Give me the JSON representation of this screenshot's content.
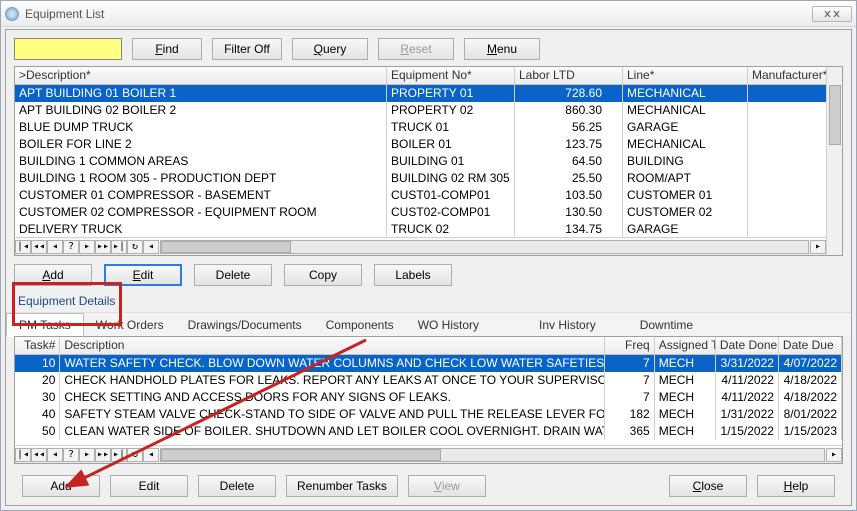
{
  "title": "Equipment List",
  "toolbar": {
    "find": "Find",
    "filter_off": "Filter Off",
    "query": "Query",
    "reset": "Reset",
    "menu": "Menu"
  },
  "columns": [
    ">Description*",
    "Equipment No*",
    "Labor LTD",
    "Line*",
    "Manufacturer*"
  ],
  "rows": [
    {
      "desc": "APT BUILDING 01 BOILER 1",
      "eq": "PROPERTY 01",
      "labor": "728.60",
      "line": "MECHANICAL",
      "mfr": ""
    },
    {
      "desc": "APT BUILDING 02 BOILER 2",
      "eq": "PROPERTY 02",
      "labor": "860.30",
      "line": "MECHANICAL",
      "mfr": ""
    },
    {
      "desc": "BLUE DUMP TRUCK",
      "eq": "TRUCK 01",
      "labor": "56.25",
      "line": "GARAGE",
      "mfr": ""
    },
    {
      "desc": "BOILER FOR LINE 2",
      "eq": "BOILER 01",
      "labor": "123.75",
      "line": "MECHANICAL",
      "mfr": ""
    },
    {
      "desc": "BUILDING 1 COMMON AREAS",
      "eq": "BUILDING 01",
      "labor": "64.50",
      "line": "BUILDING",
      "mfr": ""
    },
    {
      "desc": "BUILDING 1 ROOM 305 - PRODUCTION DEPT",
      "eq": "BUILDING 02 RM 305",
      "labor": "25.50",
      "line": "ROOM/APT",
      "mfr": ""
    },
    {
      "desc": "CUSTOMER 01 COMPRESSOR - BASEMENT",
      "eq": "CUST01-COMP01",
      "labor": "103.50",
      "line": "CUSTOMER 01",
      "mfr": ""
    },
    {
      "desc": "CUSTOMER 02 COMPRESSOR - EQUIPMENT ROOM",
      "eq": "CUST02-COMP01",
      "labor": "130.50",
      "line": "CUSTOMER 02",
      "mfr": ""
    },
    {
      "desc": "DELIVERY TRUCK",
      "eq": "TRUCK 02",
      "labor": "134.75",
      "line": "GARAGE",
      "mfr": ""
    }
  ],
  "crud": {
    "add": "Add",
    "edit": "Edit",
    "delete": "Delete",
    "copy": "Copy",
    "labels": "Labels"
  },
  "details_header": "Equipment Details",
  "tabs": [
    "PM Tasks",
    "Work Orders",
    "Drawings/Documents",
    "Components",
    "WO History",
    "Inv History",
    "Downtime"
  ],
  "columns2": [
    "Task#",
    "Description",
    "Freq",
    "Assigned T",
    "Date Done",
    "Date Due"
  ],
  "rows2": [
    {
      "t": "10",
      "d": "WATER SAFETY CHECK. BLOW DOWN WATER COLUMNS AND CHECK LOW WATER SAFETIES. IF THE",
      "f": "7",
      "a": "MECH",
      "done": "3/31/2022",
      "due": "4/07/2022"
    },
    {
      "t": "20",
      "d": "CHECK HANDHOLD PLATES FOR LEAKS. REPORT ANY LEAKS AT ONCE TO YOUR SUPERVISOR.",
      "f": "7",
      "a": "MECH",
      "done": "4/11/2022",
      "due": "4/18/2022"
    },
    {
      "t": "30",
      "d": "CHECK SETTING AND ACCESS DOORS FOR ANY SIGNS OF LEAKS.",
      "f": "7",
      "a": "MECH",
      "done": "4/11/2022",
      "due": "4/18/2022"
    },
    {
      "t": "40",
      "d": "SAFETY STEAM VALVE CHECK-STAND TO SIDE OF VALVE AND PULL THE RELEASE LEVER FOR THREE",
      "f": "182",
      "a": "MECH",
      "done": "1/31/2022",
      "due": "8/01/2022"
    },
    {
      "t": "50",
      "d": "CLEAN WATER SIDE OF BOILER.  SHUTDOWN AND LET BOILER COOL OVERNIGHT. DRAIN WATER SL",
      "f": "365",
      "a": "MECH",
      "done": "1/15/2022",
      "due": "1/15/2023"
    }
  ],
  "crud2": {
    "add": "Add",
    "edit": "Edit",
    "delete": "Delete",
    "renumber": "Renumber Tasks",
    "view": "View",
    "close": "Close",
    "help": "Help"
  }
}
